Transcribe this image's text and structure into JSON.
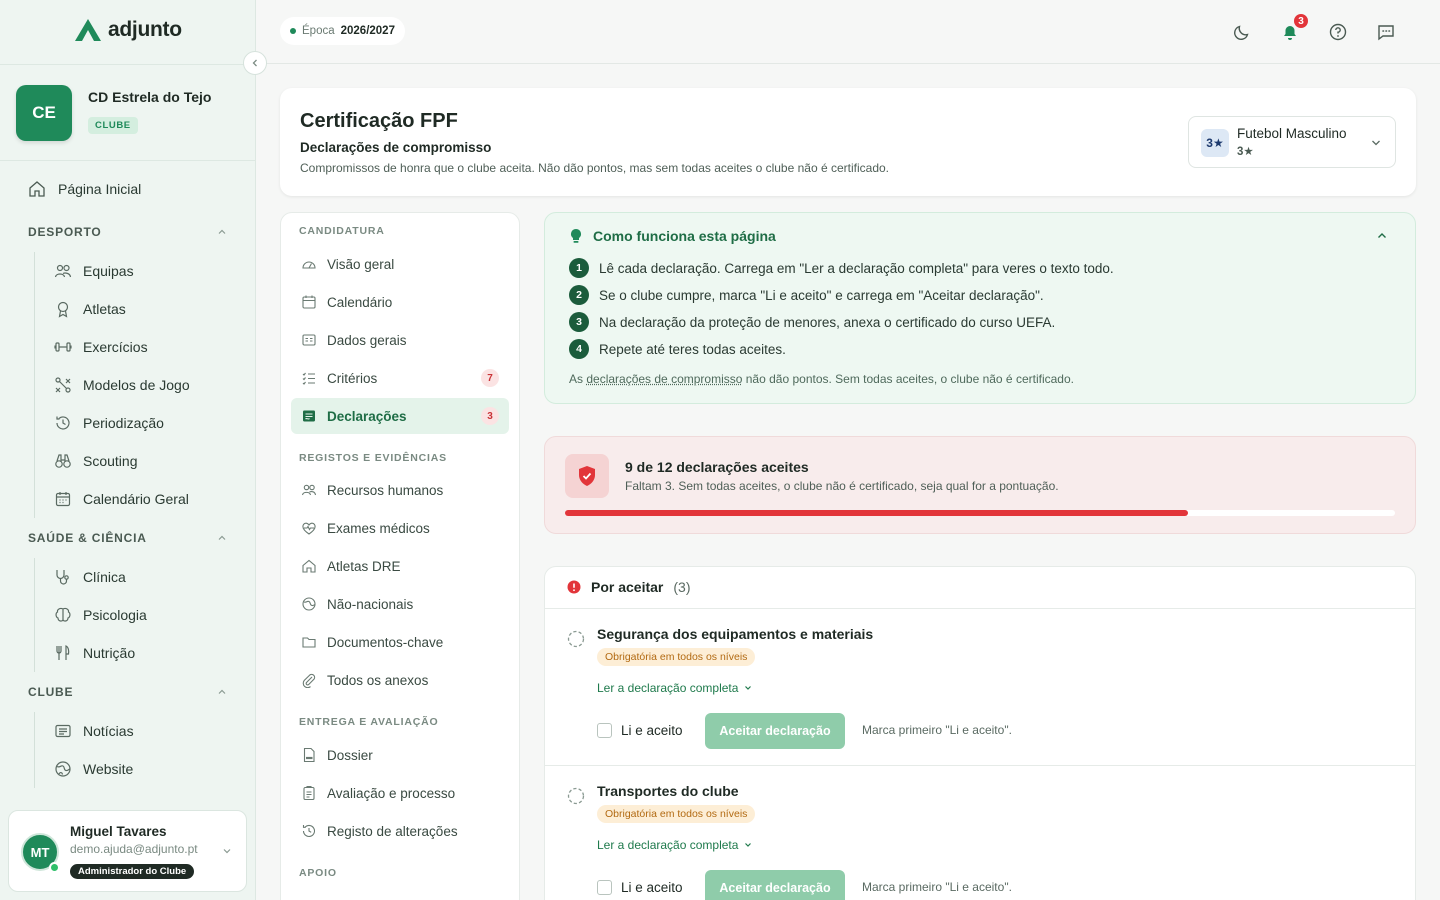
{
  "brand": {
    "name": "adjunto"
  },
  "club": {
    "initials": "CE",
    "name": "CD Estrela do Tejo",
    "tag": "CLUBE"
  },
  "sidebar": {
    "home": "Página Inicial",
    "sections": [
      {
        "title": "DESPORTO",
        "items": [
          "Equipas",
          "Atletas",
          "Exercícios",
          "Modelos de Jogo",
          "Periodização",
          "Scouting",
          "Calendário Geral"
        ]
      },
      {
        "title": "SAÚDE & CIÊNCIA",
        "items": [
          "Clínica",
          "Psicologia",
          "Nutrição"
        ]
      },
      {
        "title": "CLUBE",
        "items": [
          "Notícias",
          "Website"
        ]
      }
    ]
  },
  "user": {
    "initials": "MT",
    "name": "Miguel Tavares",
    "email": "demo.ajuda@adjunto.pt",
    "role": "Administrador do Clube"
  },
  "topbar": {
    "season_label": "Época",
    "season_value": "2026/2027",
    "notifications": "3"
  },
  "header": {
    "title": "Certificação FPF",
    "subtitle": "Declarações de compromisso",
    "description": "Compromissos de honra que o clube aceita. Não dão pontos, mas sem todas aceites o clube não é certificado.",
    "team": {
      "badge": "3★",
      "name": "Futebol Masculino",
      "level": "3★"
    }
  },
  "subnav": {
    "sections": [
      {
        "title": "CANDIDATURA",
        "items": [
          {
            "label": "Visão geral"
          },
          {
            "label": "Calendário"
          },
          {
            "label": "Dados gerais"
          },
          {
            "label": "Critérios",
            "count": "7"
          },
          {
            "label": "Declarações",
            "count": "3",
            "active": true
          }
        ]
      },
      {
        "title": "REGISTOS E EVIDÊNCIAS",
        "items": [
          {
            "label": "Recursos humanos"
          },
          {
            "label": "Exames médicos"
          },
          {
            "label": "Atletas DRE"
          },
          {
            "label": "Não-nacionais"
          },
          {
            "label": "Documentos-chave"
          },
          {
            "label": "Todos os anexos"
          }
        ]
      },
      {
        "title": "ENTREGA E AVALIAÇÃO",
        "items": [
          {
            "label": "Dossier"
          },
          {
            "label": "Avaliação e processo"
          },
          {
            "label": "Registo de alterações"
          }
        ]
      },
      {
        "title": "APOIO",
        "items": []
      }
    ]
  },
  "howto": {
    "title": "Como funciona esta página",
    "steps": [
      "Lê cada declaração. Carrega em \"Ler a declaração completa\" para veres o texto todo.",
      "Se o clube cumpre, marca \"Li e aceito\" e carrega em \"Aceitar declaração\".",
      "Na declaração da proteção de menores, anexa o certificado do curso UEFA.",
      "Repete até teres todas aceites."
    ],
    "note_prefix": "As ",
    "note_link": "declarações de compromisso",
    "note_suffix": " não dão pontos. Sem todas aceites, o clube não é certificado."
  },
  "progress": {
    "title": "9 de 12 declarações aceites",
    "description": "Faltam 3. Sem todas aceites, o clube não é certificado, seja qual for a pontuação.",
    "accepted": 9,
    "total": 12
  },
  "pending": {
    "title": "Por aceitar",
    "count": "(3)",
    "items": [
      {
        "title": "Segurança dos equipamentos e materiais",
        "tag": "Obrigatória em todos os níveis",
        "read": "Ler a declaração completa",
        "check": "Li e aceito",
        "button": "Aceitar declaração",
        "hint": "Marca primeiro \"Li e aceito\"."
      },
      {
        "title": "Transportes do clube",
        "tag": "Obrigatória em todos os níveis",
        "read": "Ler a declaração completa",
        "check": "Li e aceito",
        "button": "Aceitar declaração",
        "hint": "Marca primeiro \"Li e aceito\"."
      }
    ]
  },
  "colors": {
    "brand": "#1f8a5a",
    "danger": "#e2353a",
    "accent_light": "#eef8f2"
  }
}
